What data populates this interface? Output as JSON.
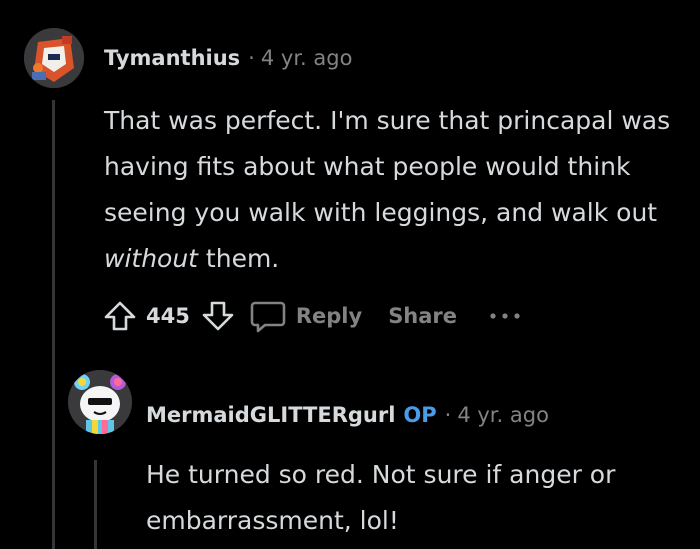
{
  "comments": [
    {
      "username": "Tymanthius",
      "separator": "·",
      "time": "4 yr. ago",
      "body_parts": [
        "That was perfect. I'm sure that princapal was having fits about what people would think seeing you walk with leggings, and walk out ",
        "without",
        " them."
      ],
      "votes": "445",
      "reply_label": "Reply",
      "share_label": "Share",
      "more_label": "···"
    },
    {
      "username": "MermaidGLITTERgurl",
      "badge": "OP",
      "separator": "·",
      "time": "4 yr. ago",
      "body": "He turned so red. Not sure if anger or embarrassment, lol!"
    }
  ],
  "colors": {
    "background": "#000000",
    "text": "#d7dadc",
    "meta": "#818384",
    "op_badge": "#4a9be8",
    "thread_line": "#343536"
  }
}
